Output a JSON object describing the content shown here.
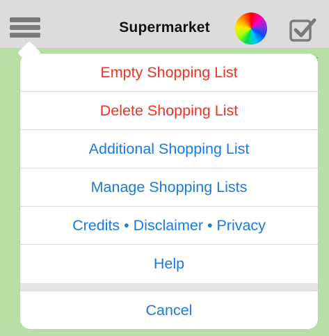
{
  "navbar": {
    "title": "Supermarket",
    "icons": {
      "menu": "hamburger-menu-icon",
      "palette": "color-wheel-icon",
      "check": "checkbox-check-icon"
    }
  },
  "colors": {
    "navbar_bg": "#dcdcdc",
    "content_bg": "#b8dfa3",
    "destructive": "#ee3224",
    "action": "#1a7ae0"
  },
  "popover": {
    "items": [
      {
        "label": "Empty Shopping List",
        "style": "destructive"
      },
      {
        "label": "Delete Shopping List",
        "style": "destructive"
      },
      {
        "label": "Additional Shopping List",
        "style": "normal"
      },
      {
        "label": "Manage Shopping Lists",
        "style": "normal"
      },
      {
        "label": "Credits • Disclaimer • Privacy",
        "style": "normal"
      },
      {
        "label": "Help",
        "style": "normal"
      }
    ],
    "cancel_label": "Cancel"
  }
}
